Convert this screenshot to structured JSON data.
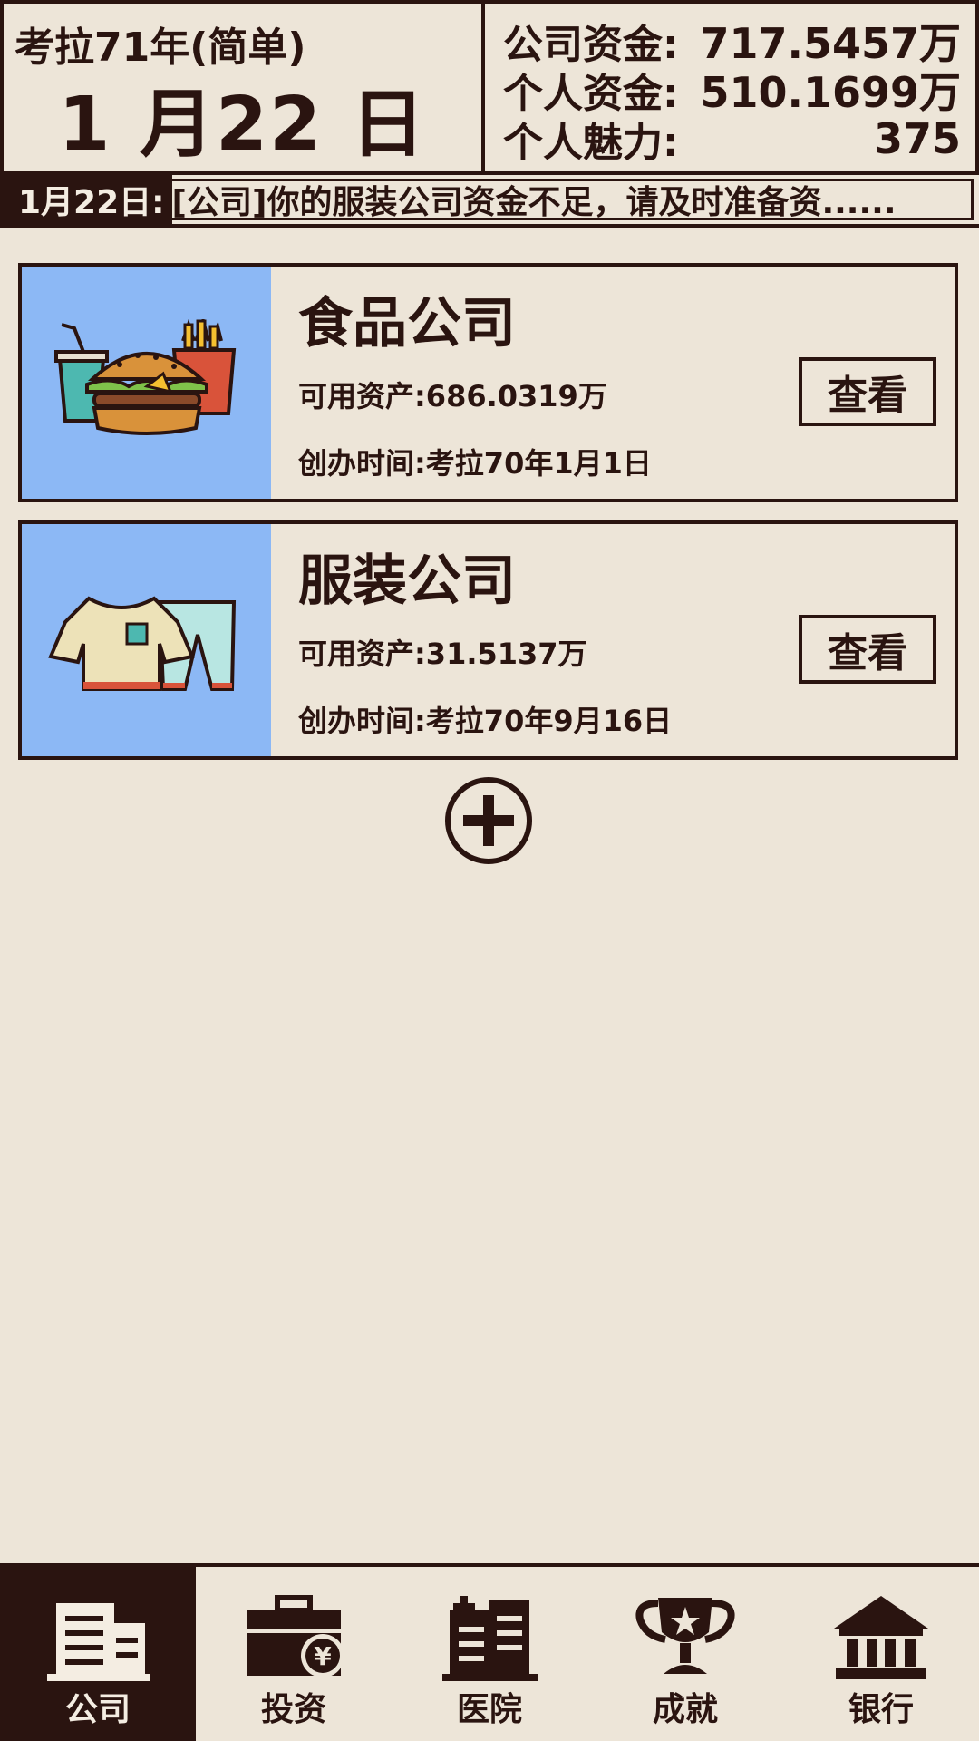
{
  "header": {
    "year_mode": "考拉71年(简单)",
    "date": "1 月22 日",
    "stats": [
      {
        "label": "公司资金:",
        "value": "717.5457万"
      },
      {
        "label": "个人资金:",
        "value": "510.1699万"
      },
      {
        "label": "个人魅力:",
        "value": "375"
      }
    ]
  },
  "ticker": {
    "date": "1月22日:",
    "message": "[公司]你的服装公司资金不足，请及时准备资......"
  },
  "companies": [
    {
      "name": "食品公司",
      "assets": "可用资产:686.0319万",
      "founded": "创办时间:考拉70年1月1日",
      "button": "查看",
      "icon": "food-icon"
    },
    {
      "name": "服装公司",
      "assets": "可用资产:31.5137万",
      "founded": "创办时间:考拉70年9月16日",
      "button": "查看",
      "icon": "clothing-icon"
    }
  ],
  "add_icon": "plus-circle-icon",
  "nav": [
    {
      "label": "公司",
      "icon": "building-icon",
      "active": true
    },
    {
      "label": "投资",
      "icon": "briefcase-yen-icon",
      "active": false
    },
    {
      "label": "医院",
      "icon": "hospital-icon",
      "active": false
    },
    {
      "label": "成就",
      "icon": "trophy-icon",
      "active": false
    },
    {
      "label": "银行",
      "icon": "bank-icon",
      "active": false
    }
  ],
  "colors": {
    "background": "#ede5d8",
    "ink": "#2a1410",
    "card_image_bg": "#8cb8f5"
  }
}
